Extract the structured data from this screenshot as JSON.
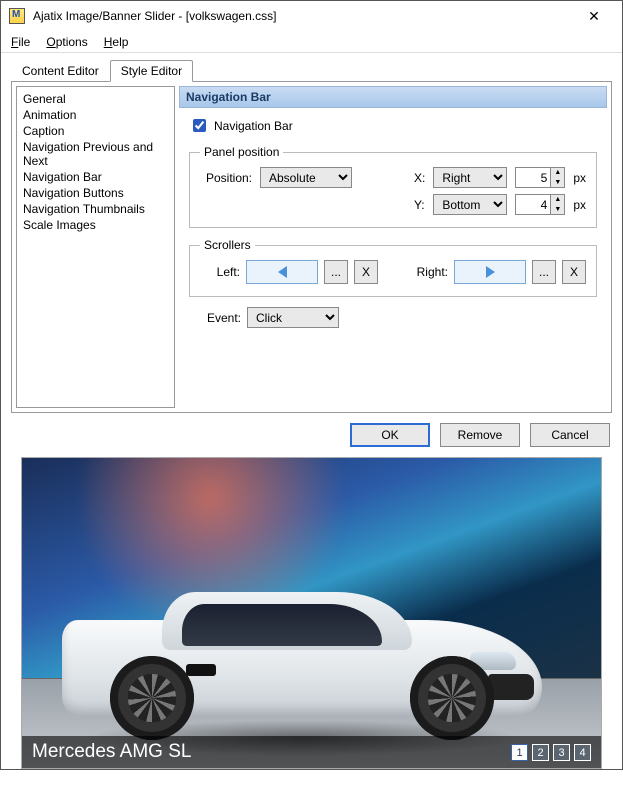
{
  "window": {
    "title": "Ajatix Image/Banner Slider - [volkswagen.css]"
  },
  "menu": {
    "file": "File",
    "options": "Options",
    "help": "Help"
  },
  "tabs": {
    "content": "Content Editor",
    "style": "Style Editor"
  },
  "sidebar": {
    "items": [
      "General",
      "Animation",
      "Caption",
      "Navigation Previous and Next",
      "Navigation Bar",
      "Navigation Buttons",
      "Navigation Thumbnails",
      "Scale Images"
    ]
  },
  "section": {
    "title": "Navigation Bar",
    "checkbox_label": "Navigation Bar",
    "panel_legend": "Panel position",
    "position_label": "Position:",
    "position_value": "Absolute",
    "x_label": "X:",
    "x_anchor": "Right",
    "x_value": "5",
    "px": "px",
    "y_label": "Y:",
    "y_anchor": "Bottom",
    "y_value": "4",
    "scrollers_legend": "Scrollers",
    "left_label": "Left:",
    "right_label": "Right:",
    "dots": "...",
    "x_btn": "X",
    "event_label": "Event:",
    "event_value": "Click"
  },
  "buttons": {
    "ok": "OK",
    "remove": "Remove",
    "cancel": "Cancel"
  },
  "preview": {
    "caption": "Mercedes AMG SL",
    "pages": [
      "1",
      "2",
      "3",
      "4"
    ],
    "active": 0
  }
}
